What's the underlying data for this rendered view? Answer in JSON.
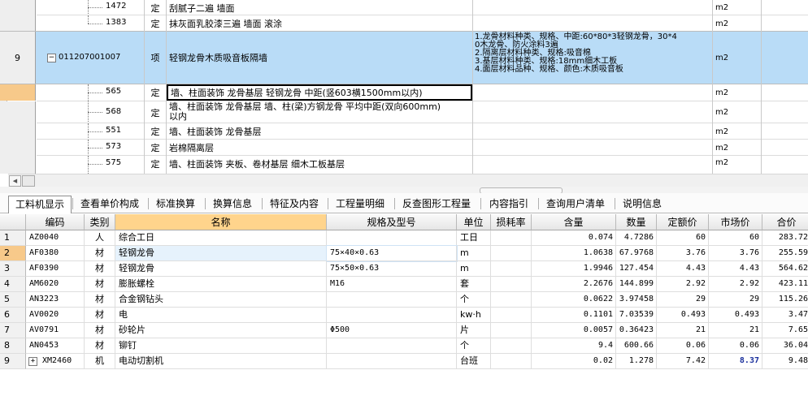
{
  "top_grid": {
    "rows": [
      {
        "num": "",
        "code": "1472",
        "type": "定",
        "name": "刮腻子二遍 墙面",
        "feature": "",
        "unit": "m2"
      },
      {
        "num": "",
        "code": "1383",
        "type": "定",
        "name": "抹灰面乳胶漆三遍 墙面 滚涂",
        "feature": "",
        "unit": "m2"
      },
      {
        "num": "9",
        "code": "011207001007",
        "type": "项",
        "name": "轻钢龙骨木质吸音板隔墙",
        "feature_lines": [
          "1.龙骨材料种类、规格、中距:60*80*3轻钢龙骨，30*4",
          "0木龙骨、防火涂料3遍",
          "2.隔离层材料种类、规格:吸音棉",
          "3.基层材料种类、规格:18mm细木工板",
          "4.面层材料品种、规格、颜色:木质吸音板"
        ],
        "unit": "m2",
        "expand_symbol": "−"
      },
      {
        "num": "",
        "code": "565",
        "type": "定",
        "name": "墙、柱面装饰 龙骨基层 轻钢龙骨 中距(竖603横1500mm以内)",
        "feature": "",
        "unit": "m2"
      },
      {
        "num": "",
        "code": "568",
        "type": "定",
        "name_lines": [
          "墙、柱面装饰 龙骨基层 墙、柱(梁)方钢龙骨 平均中距(双向600mm)",
          "以内"
        ],
        "feature": "",
        "unit": "m2"
      },
      {
        "num": "",
        "code": "551",
        "type": "定",
        "name": "墙、柱面装饰 龙骨基层",
        "feature": "",
        "unit": "m2"
      },
      {
        "num": "",
        "code": "573",
        "type": "定",
        "name": "岩棉隔离层",
        "feature": "",
        "unit": "m2"
      },
      {
        "num": "",
        "code": "575",
        "type": "定",
        "name": "墙、柱面装饰 夹板、卷材基层 细木工板基层",
        "feature": "",
        "unit": "m2"
      }
    ]
  },
  "tabs": [
    "工料机显示",
    "查看单价构成",
    "标准换算",
    "换算信息",
    "特征及内容",
    "工程量明细",
    "反查图形工程量",
    "内容指引",
    "查询用户清单",
    "说明信息"
  ],
  "active_tab": "工料机显示",
  "bottom_grid": {
    "headers": [
      "编码",
      "类别",
      "名称",
      "规格及型号",
      "单位",
      "损耗率",
      "含量",
      "数量",
      "定额价",
      "市场价",
      "合价"
    ],
    "rows": [
      {
        "n": "1",
        "code": "AZ0040",
        "cat": "人",
        "name": "综合工日",
        "spec": "",
        "unit": "工日",
        "loss": "",
        "qty": "0.074",
        "amount": "4.7286",
        "quota": "60",
        "market": "60",
        "total": "283.72"
      },
      {
        "n": "2",
        "code": "AF0380",
        "cat": "材",
        "name": "轻钢龙骨",
        "spec": "75×40×0.63",
        "unit": "m",
        "loss": "",
        "qty": "1.0638",
        "amount": "67.9768",
        "quota": "3.76",
        "market": "3.76",
        "total": "255.59"
      },
      {
        "n": "3",
        "code": "AF0390",
        "cat": "材",
        "name": "轻钢龙骨",
        "spec": "75×50×0.63",
        "unit": "m",
        "loss": "",
        "qty": "1.9946",
        "amount": "127.454",
        "quota": "4.43",
        "market": "4.43",
        "total": "564.62"
      },
      {
        "n": "4",
        "code": "AM6020",
        "cat": "材",
        "name": "膨胀螺栓",
        "spec": "M16",
        "unit": "套",
        "loss": "",
        "qty": "2.2676",
        "amount": "144.899",
        "quota": "2.92",
        "market": "2.92",
        "total": "423.11"
      },
      {
        "n": "5",
        "code": "AN3223",
        "cat": "材",
        "name": "合金钢钻头",
        "spec": "",
        "unit": "个",
        "loss": "",
        "qty": "0.0622",
        "amount": "3.97458",
        "quota": "29",
        "market": "29",
        "total": "115.26"
      },
      {
        "n": "6",
        "code": "AV0020",
        "cat": "材",
        "name": "电",
        "spec": "",
        "unit": "kw·h",
        "loss": "",
        "qty": "0.1101",
        "amount": "7.03539",
        "quota": "0.493",
        "market": "0.493",
        "total": "3.47"
      },
      {
        "n": "7",
        "code": "AV0791",
        "cat": "材",
        "name": "砂轮片",
        "spec": "Φ500",
        "unit": "片",
        "loss": "",
        "qty": "0.0057",
        "amount": "0.36423",
        "quota": "21",
        "market": "21",
        "total": "7.65"
      },
      {
        "n": "8",
        "code": "AN0453",
        "cat": "材",
        "name": "铆钉",
        "spec": "",
        "unit": "个",
        "loss": "",
        "qty": "9.4",
        "amount": "600.66",
        "quota": "0.06",
        "market": "0.06",
        "total": "36.04"
      },
      {
        "n": "9",
        "code": "XM2460",
        "cat": "机",
        "name": "电动切割机",
        "spec": "",
        "unit": "台班",
        "loss": "",
        "qty": "0.02",
        "amount": "1.278",
        "quota": "7.42",
        "market": "8.37",
        "total": "9.48",
        "expand_symbol": "+"
      }
    ]
  },
  "colors": {
    "selected_row": "#b9dcf7",
    "header_selected": "#ffd48c",
    "row_number_highlight": "#f7c98a",
    "market_blue": "#1a2f9c"
  }
}
